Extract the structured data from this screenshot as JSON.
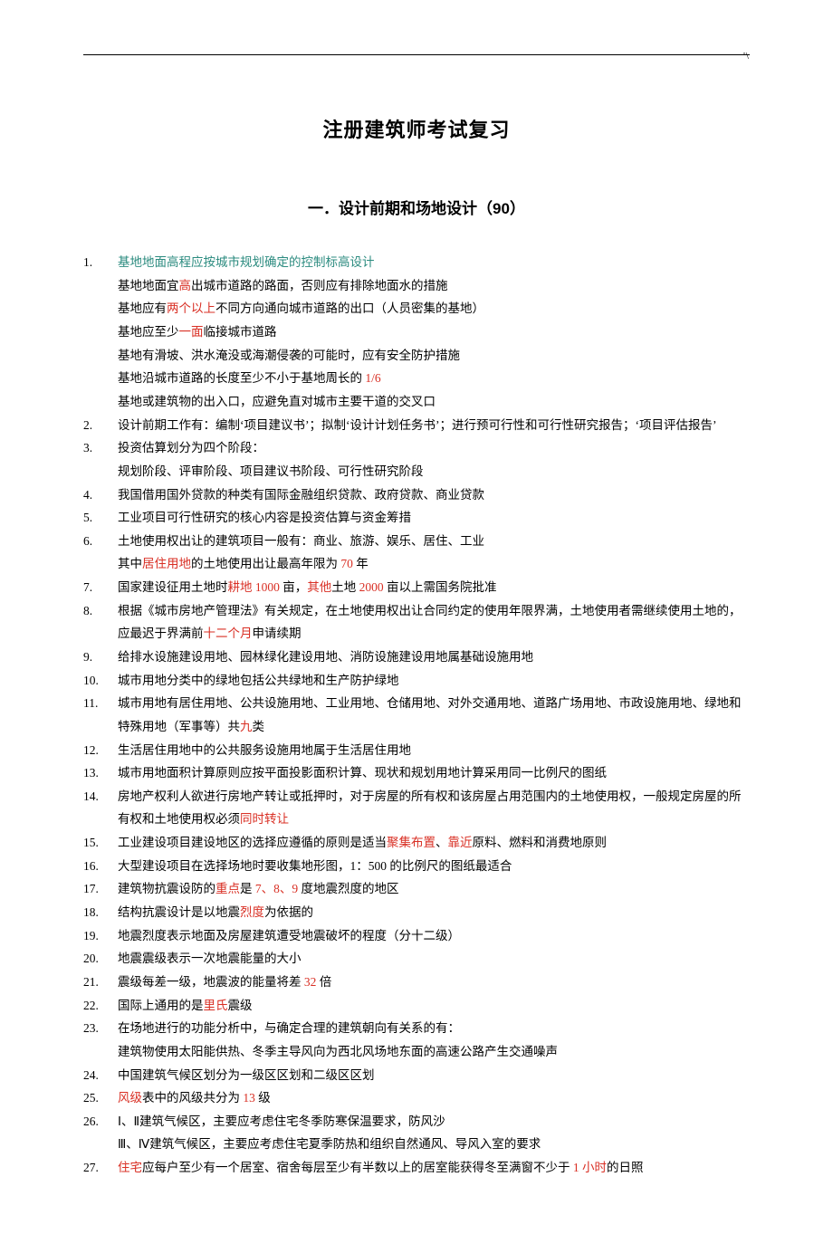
{
  "tick": "'\\",
  "title": "注册建筑师考试复习",
  "section": "一．设计前期和场地设计（90）",
  "items": [
    {
      "num": "1.",
      "lines": [
        {
          "segs": [
            {
              "t": "基地地面高程应按城市规划确定的控制标高设计",
              "cls": "hl-teal"
            }
          ]
        },
        {
          "segs": [
            {
              "t": "基地地面宜"
            },
            {
              "t": "高",
              "cls": "hl-red"
            },
            {
              "t": "出城市道路的路面，否则应有排除地面水的措施"
            }
          ]
        },
        {
          "segs": [
            {
              "t": "基地应有"
            },
            {
              "t": "两个以上",
              "cls": "hl-red"
            },
            {
              "t": "不同方向通向城市道路的出口（人员密集的基地）"
            }
          ]
        },
        {
          "segs": [
            {
              "t": "基地应至少"
            },
            {
              "t": "一面",
              "cls": "hl-red"
            },
            {
              "t": "临接城市道路"
            }
          ]
        },
        {
          "segs": [
            {
              "t": "基地有滑坡、洪水淹没或海潮侵袭的可能时，应有安全防护措施"
            }
          ]
        },
        {
          "segs": [
            {
              "t": "基地沿城市道路的长度至少不小于基地周长的 "
            },
            {
              "t": "1/6",
              "cls": "hl-red"
            }
          ]
        },
        {
          "segs": [
            {
              "t": "基地或建筑物的出入口，应避免直对城市主要干道的交叉口"
            }
          ]
        }
      ]
    },
    {
      "num": "2.",
      "lines": [
        {
          "segs": [
            {
              "t": "设计前期工作有：编制‘项目建议书’；拟制‘设计计划任务书’；进行预可行性和可行性研究报告；‘项目评估报告’"
            }
          ]
        }
      ]
    },
    {
      "num": "3.",
      "lines": [
        {
          "segs": [
            {
              "t": "投资估算划分为四个阶段："
            }
          ]
        },
        {
          "segs": [
            {
              "t": "规划阶段、评审阶段、项目建议书阶段、可行性研究阶段"
            }
          ]
        }
      ]
    },
    {
      "num": "4.",
      "lines": [
        {
          "segs": [
            {
              "t": "我国借用国外贷款的种类有国际金融组织贷款、政府贷款、商业贷款"
            }
          ]
        }
      ]
    },
    {
      "num": "5.",
      "lines": [
        {
          "segs": [
            {
              "t": "工业项目可行性研究的核心内容是投资估算与资金筹措"
            }
          ]
        }
      ]
    },
    {
      "num": "6.",
      "lines": [
        {
          "segs": [
            {
              "t": "土地使用权出让的建筑项目一般有：商业、旅游、娱乐、居住、工业"
            }
          ]
        },
        {
          "segs": [
            {
              "t": "其中"
            },
            {
              "t": "居住用地",
              "cls": "hl-red"
            },
            {
              "t": "的土地使用出让最高年限为 "
            },
            {
              "t": "70",
              "cls": "hl-red"
            },
            {
              "t": " 年"
            }
          ]
        }
      ]
    },
    {
      "num": "7.",
      "lines": [
        {
          "segs": [
            {
              "t": "国家建设征用土地时"
            },
            {
              "t": "耕地 1000",
              "cls": "hl-red"
            },
            {
              "t": " 亩，"
            },
            {
              "t": "其他",
              "cls": "hl-red"
            },
            {
              "t": "土地 "
            },
            {
              "t": "2000",
              "cls": "hl-red"
            },
            {
              "t": " 亩以上需国务院批准"
            }
          ]
        }
      ]
    },
    {
      "num": "8.",
      "lines": [
        {
          "segs": [
            {
              "t": "根据《城市房地产管理法》有关规定，在土地使用权出让合同约定的使用年限界满，土地使用者需继续使用土地的，应最迟于界满前"
            },
            {
              "t": "十二个月",
              "cls": "hl-red"
            },
            {
              "t": "申请续期"
            }
          ]
        }
      ]
    },
    {
      "num": "9.",
      "lines": [
        {
          "segs": [
            {
              "t": "给排水设施建设用地、园林绿化建设用地、消防设施建设用地属基础设施用地"
            }
          ]
        }
      ]
    },
    {
      "num": "10.",
      "lines": [
        {
          "segs": [
            {
              "t": "城市用地分类中的绿地包括公共绿地和生产防护绿地"
            }
          ]
        }
      ]
    },
    {
      "num": "11.",
      "lines": [
        {
          "segs": [
            {
              "t": "城市用地有居住用地、公共设施用地、工业用地、仓储用地、对外交通用地、道路广场用地、市政设施用地、绿地和特殊用地（军事等）共"
            },
            {
              "t": "九",
              "cls": "hl-red"
            },
            {
              "t": "类"
            }
          ]
        }
      ]
    },
    {
      "num": "12.",
      "lines": [
        {
          "segs": [
            {
              "t": "生活居住用地中的公共服务设施用地属于生活居住用地"
            }
          ]
        }
      ]
    },
    {
      "num": "13.",
      "lines": [
        {
          "segs": [
            {
              "t": "城市用地面积计算原则应按平面投影面积计算、现状和规划用地计算采用同一比例尺的图纸"
            }
          ]
        }
      ]
    },
    {
      "num": "14.",
      "lines": [
        {
          "segs": [
            {
              "t": "房地产权利人欲进行房地产转让或抵押时，对于房屋的所有权和该房屋占用范围内的土地使用权，一般规定房屋的所有权和土地使用权必须"
            },
            {
              "t": "同时转让",
              "cls": "hl-red"
            }
          ]
        }
      ]
    },
    {
      "num": "15.",
      "lines": [
        {
          "segs": [
            {
              "t": "工业建设项目建设地区的选择应遵循的原则是适当"
            },
            {
              "t": "聚集布置",
              "cls": "hl-red"
            },
            {
              "t": "、"
            },
            {
              "t": "靠近",
              "cls": "hl-red"
            },
            {
              "t": "原料、燃料和消费地原则"
            }
          ]
        }
      ]
    },
    {
      "num": "16.",
      "lines": [
        {
          "segs": [
            {
              "t": "大型建设项目在选择场地时要收集地形图，1：500 的比例尺的图纸最适合"
            }
          ]
        }
      ]
    },
    {
      "num": "17.",
      "lines": [
        {
          "segs": [
            {
              "t": "建筑物抗震设防的"
            },
            {
              "t": "重点",
              "cls": "hl-red"
            },
            {
              "t": "是 "
            },
            {
              "t": "7、8、9",
              "cls": "hl-red"
            },
            {
              "t": " 度地震烈度的地区"
            }
          ]
        }
      ]
    },
    {
      "num": "18.",
      "lines": [
        {
          "segs": [
            {
              "t": "结构抗震设计是以地震"
            },
            {
              "t": "烈度",
              "cls": "hl-red"
            },
            {
              "t": "为依据的"
            }
          ]
        }
      ]
    },
    {
      "num": "19.",
      "lines": [
        {
          "segs": [
            {
              "t": "地震烈度表示地面及房屋建筑遭受地震破坏的程度（分十二级）"
            }
          ]
        }
      ]
    },
    {
      "num": "20.",
      "lines": [
        {
          "segs": [
            {
              "t": "地震震级表示一次地震能量的大小"
            }
          ]
        }
      ]
    },
    {
      "num": "21.",
      "lines": [
        {
          "segs": [
            {
              "t": "震级每差一级，地震波的能量将差 "
            },
            {
              "t": "32",
              "cls": "hl-red"
            },
            {
              "t": " 倍"
            }
          ]
        }
      ]
    },
    {
      "num": "22.",
      "lines": [
        {
          "segs": [
            {
              "t": "国际上通用的是"
            },
            {
              "t": "里氏",
              "cls": "hl-red"
            },
            {
              "t": "震级"
            }
          ]
        }
      ]
    },
    {
      "num": "23.",
      "lines": [
        {
          "segs": [
            {
              "t": "在场地进行的功能分析中，与确定合理的建筑朝向有关系的有："
            }
          ]
        },
        {
          "segs": [
            {
              "t": "建筑物使用太阳能供热、冬季主导风向为西北风场地东面的高速公路产生交通噪声"
            }
          ]
        }
      ]
    },
    {
      "num": "24.",
      "lines": [
        {
          "segs": [
            {
              "t": "中国建筑气候区划分为一级区区划和二级区区划"
            }
          ]
        }
      ]
    },
    {
      "num": "25.",
      "lines": [
        {
          "segs": [
            {
              "t": "风级",
              "cls": "hl-red"
            },
            {
              "t": "表中的风级共分为 "
            },
            {
              "t": "13",
              "cls": "hl-red"
            },
            {
              "t": " 级"
            }
          ]
        }
      ]
    },
    {
      "num": "26.",
      "lines": [
        {
          "segs": [
            {
              "t": "Ⅰ、Ⅱ建筑气候区，主要应考虑住宅冬季防寒保温要求，防风沙"
            }
          ]
        },
        {
          "segs": [
            {
              "t": "Ⅲ、Ⅳ建筑气候区，主要应考虑住宅夏季防热和组织自然通风、导风入室的要求"
            }
          ]
        }
      ]
    },
    {
      "num": "27.",
      "lines": [
        {
          "segs": [
            {
              "t": "住宅",
              "cls": "hl-red"
            },
            {
              "t": "应每户至少有一个居室、宿舍每层至少有半数以上的居室能获得冬至满窗不少于 "
            },
            {
              "t": "1 小时",
              "cls": "hl-red"
            },
            {
              "t": "的日照"
            }
          ]
        }
      ]
    }
  ]
}
